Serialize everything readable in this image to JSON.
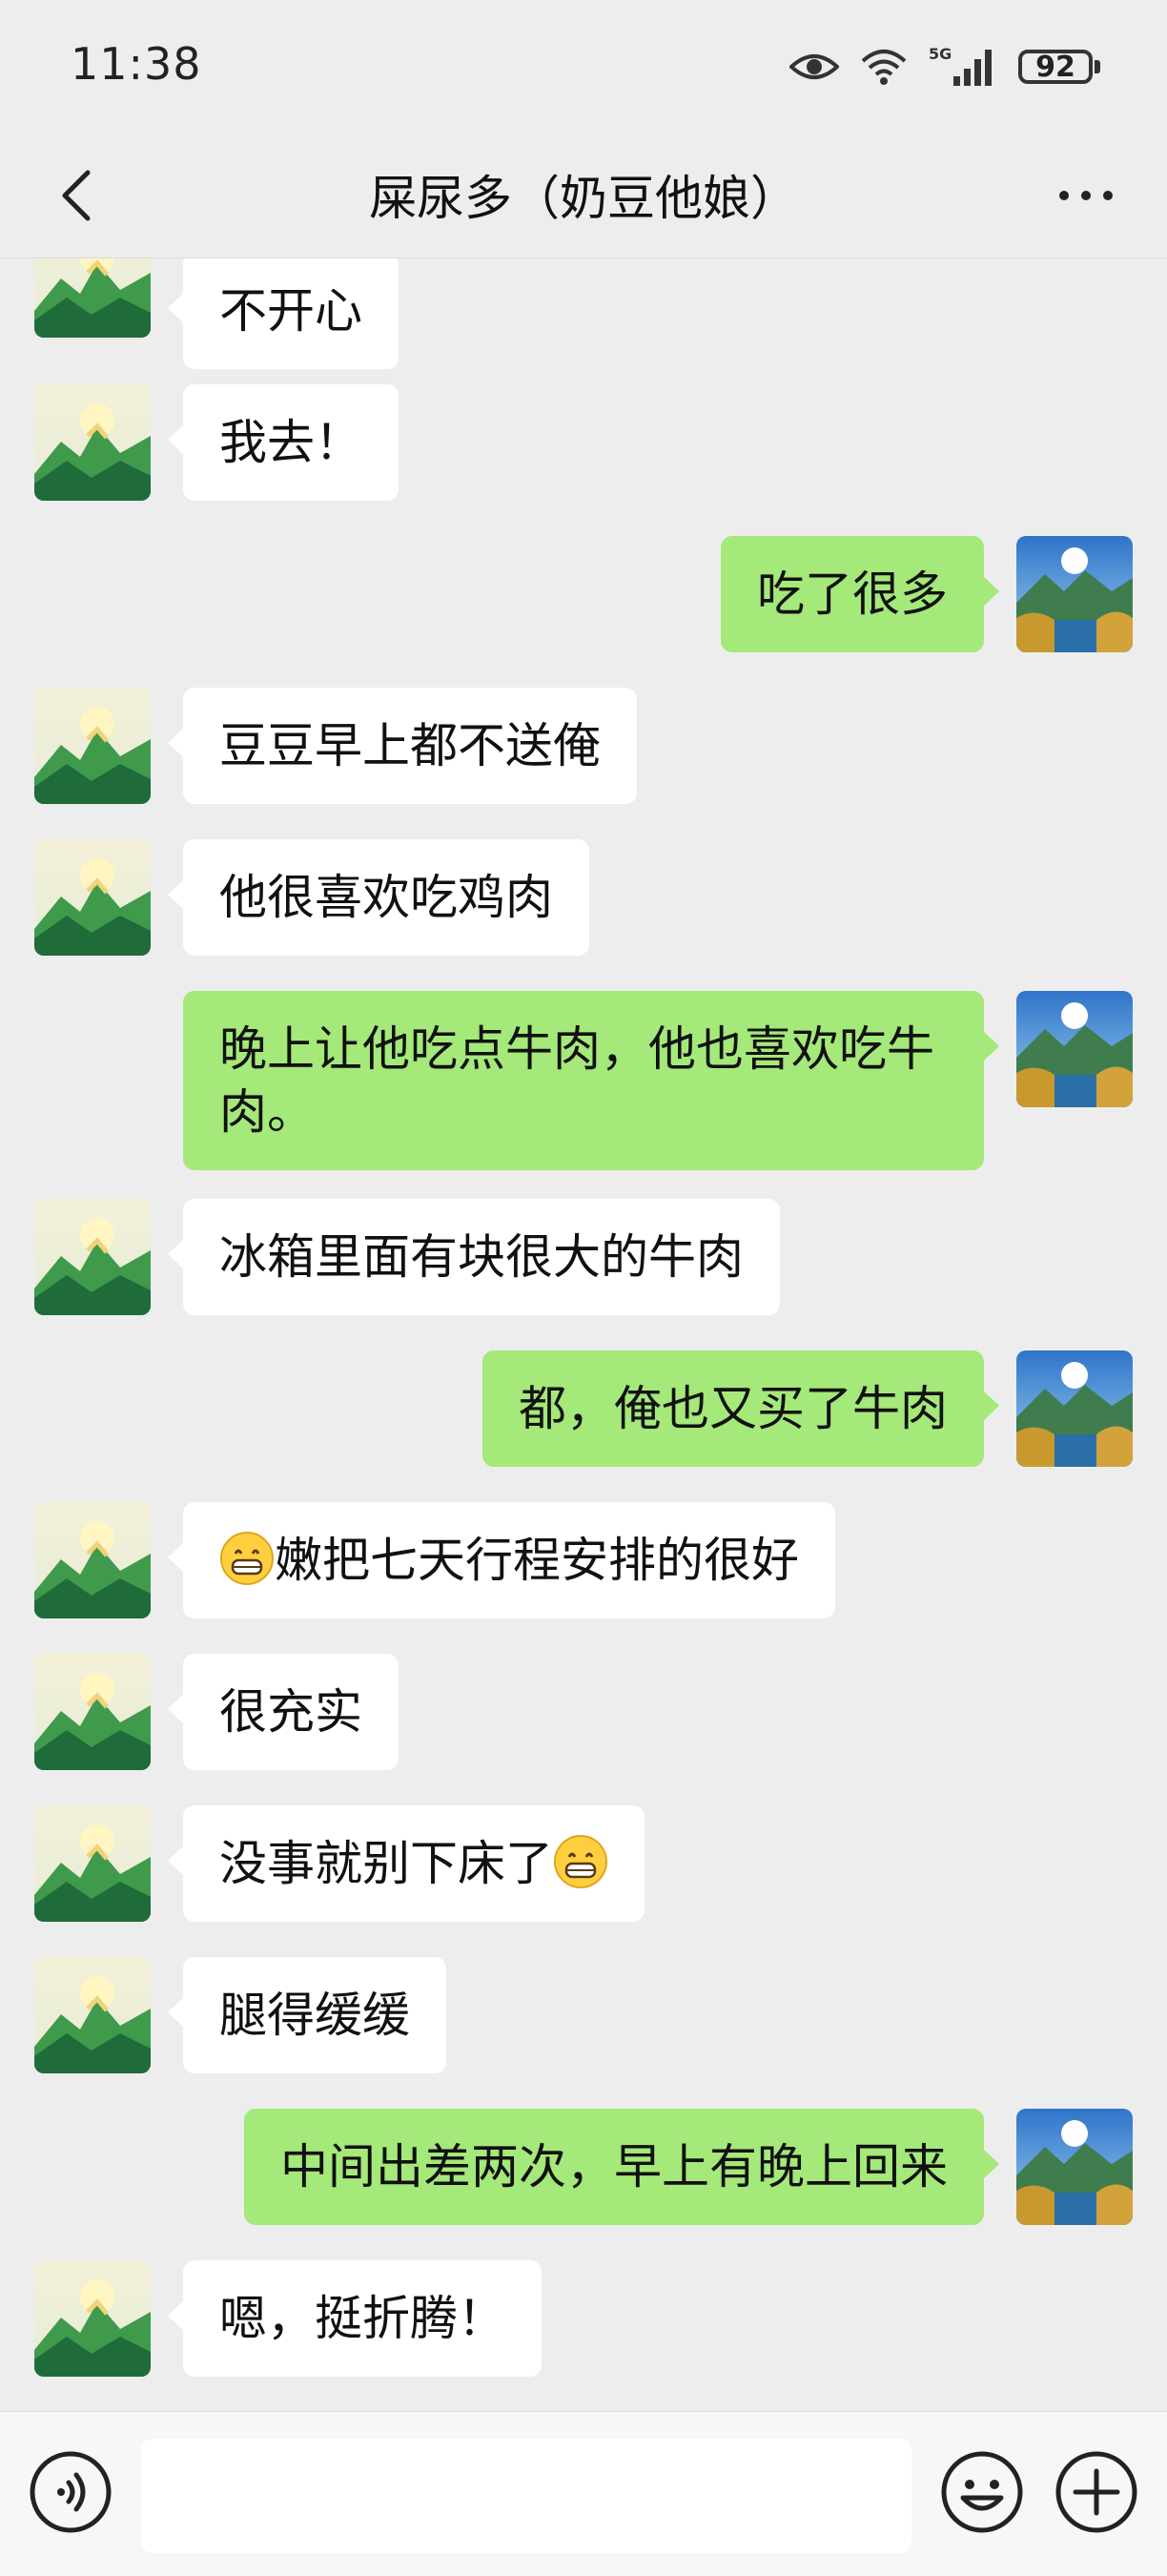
{
  "status_bar": {
    "time": "11:38",
    "network": "5G",
    "battery": "92"
  },
  "header": {
    "title": "屎尿多（奶豆他娘）",
    "back_icon": "chevron-left-icon",
    "more_icon": "more-dots-icon"
  },
  "messages": [
    {
      "side": "left",
      "text": "不开心"
    },
    {
      "side": "left",
      "text": "我去！"
    },
    {
      "side": "right",
      "text": "吃了很多"
    },
    {
      "side": "left",
      "text": "豆豆早上都不送俺"
    },
    {
      "side": "left",
      "text": "他很喜欢吃鸡肉"
    },
    {
      "side": "right",
      "text": "晚上让他吃点牛肉，他也喜欢吃牛肉。"
    },
    {
      "side": "left",
      "text": "冰箱里面有块很大的牛肉"
    },
    {
      "side": "right",
      "text": "都，俺也又买了牛肉"
    },
    {
      "side": "left",
      "text": "嫩把七天行程安排的很好",
      "emoji_before": "grin-emoji"
    },
    {
      "side": "left",
      "text": "很充实"
    },
    {
      "side": "left",
      "text": "没事就别下床了",
      "emoji_after": "grin-emoji"
    },
    {
      "side": "left",
      "text": "腿得缓缓"
    },
    {
      "side": "right",
      "text": "中间出差两次，早上有晚上回来"
    },
    {
      "side": "left",
      "text": "嗯，挺折腾！"
    }
  ],
  "input_bar": {
    "input_value": "",
    "voice_icon": "voice-icon",
    "emoji_icon": "emoji-smile-icon",
    "plus_icon": "plus-circle-icon"
  }
}
